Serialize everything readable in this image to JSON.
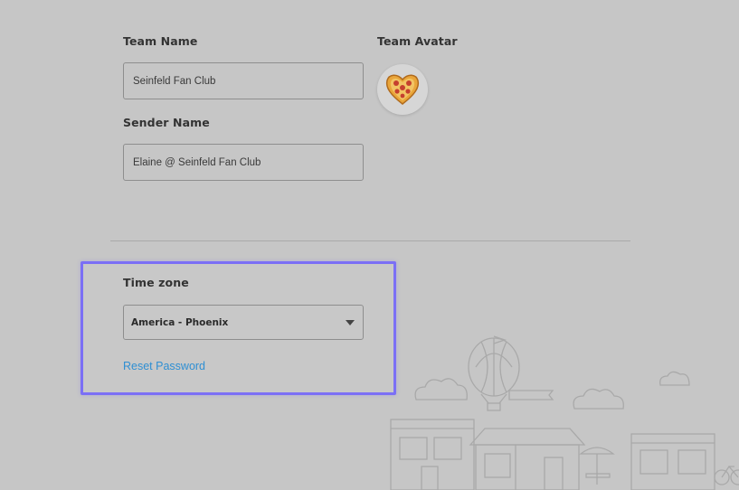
{
  "team": {
    "name_label": "Team Name",
    "name_value": "Seinfeld Fan Club",
    "avatar_label": "Team Avatar",
    "avatar_icon": "pizza-heart-icon"
  },
  "sender": {
    "label": "Sender Name",
    "value": "Elaine @ Seinfeld Fan Club"
  },
  "timezone": {
    "label": "Time zone",
    "selected": "America - Phoenix"
  },
  "links": {
    "reset_password": "Reset Password"
  },
  "colors": {
    "focus_outline": "#7b6ff5",
    "link": "#2f8fd3",
    "overlay_background": "#c6c6c6"
  }
}
